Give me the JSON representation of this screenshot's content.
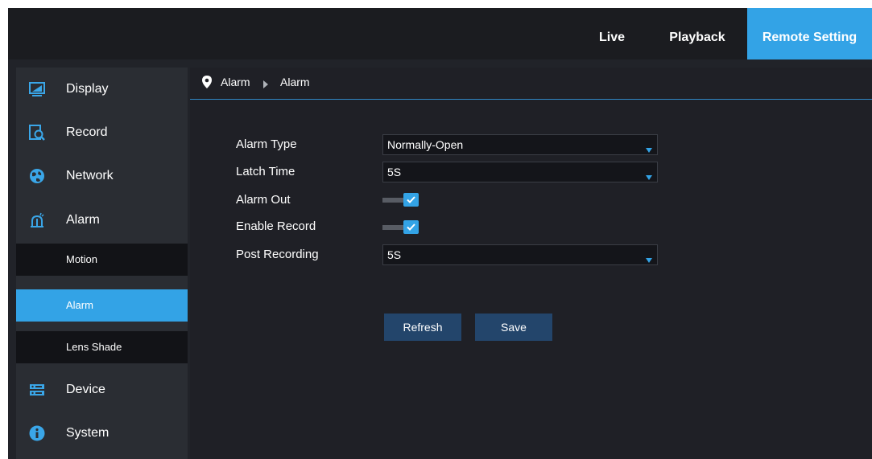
{
  "topnav": {
    "tabs": [
      {
        "label": "Live"
      },
      {
        "label": "Playback"
      },
      {
        "label": "Remote Setting",
        "active": true
      }
    ]
  },
  "sidebar": {
    "items": [
      {
        "label": "Display",
        "icon": "monitor-icon"
      },
      {
        "label": "Record",
        "icon": "record-search-icon"
      },
      {
        "label": "Network",
        "icon": "globe-icon"
      },
      {
        "label": "Alarm",
        "icon": "alarm-siren-icon"
      },
      {
        "label": "Device",
        "icon": "storage-device-icon"
      },
      {
        "label": "System",
        "icon": "info-icon"
      }
    ],
    "alarm_subitems": [
      {
        "label": "Motion"
      },
      {
        "label": "Alarm",
        "active": true
      },
      {
        "label": "Lens Shade"
      }
    ]
  },
  "breadcrumb": [
    "Alarm",
    "Alarm"
  ],
  "form": {
    "alarm_type": {
      "label": "Alarm Type",
      "value": "Normally-Open"
    },
    "latch_time": {
      "label": "Latch Time",
      "value": "5S"
    },
    "alarm_out": {
      "label": "Alarm Out",
      "checked": true
    },
    "enable_record": {
      "label": "Enable Record",
      "checked": true
    },
    "post_recording": {
      "label": "Post Recording",
      "value": "5S"
    }
  },
  "buttons": {
    "refresh": "Refresh",
    "save": "Save"
  },
  "colors": {
    "accent": "#33a3e6",
    "button": "#23456b",
    "background": "#212329"
  }
}
